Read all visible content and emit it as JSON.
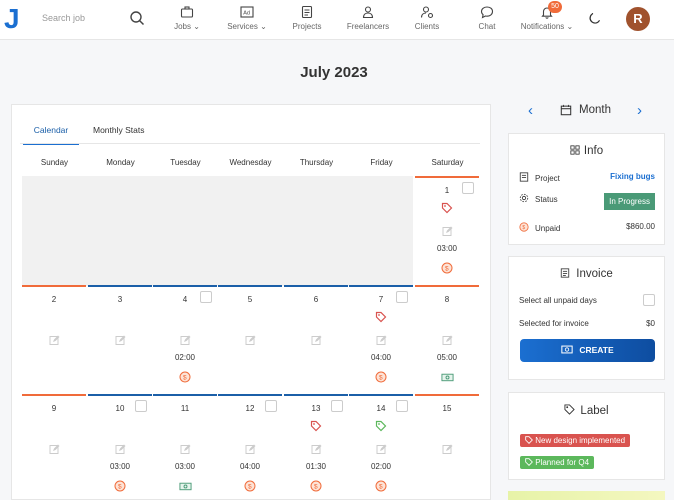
{
  "nav": {
    "search_placeholder": "Search job",
    "items": [
      {
        "label": "Jobs",
        "icon": "briefcase-icon",
        "dropdown": true
      },
      {
        "label": "Services",
        "icon": "ad-icon",
        "dropdown": true
      },
      {
        "label": "Projects",
        "icon": "document-icon"
      },
      {
        "label": "Freelancers",
        "icon": "person-icon"
      },
      {
        "label": "Clients",
        "icon": "client-icon"
      },
      {
        "label": "Chat",
        "icon": "chat-icon"
      },
      {
        "label": "Notifications",
        "icon": "bell-icon",
        "dropdown": true
      }
    ],
    "notification_count": "50",
    "avatar_initial": "R"
  },
  "page": {
    "title": "July 2023"
  },
  "calendar": {
    "tabs": [
      "Calendar",
      "Monthly Stats"
    ],
    "weekdays": [
      "Sunday",
      "Monday",
      "Tuesday",
      "Wednesday",
      "Thursday",
      "Friday",
      "Saturday"
    ],
    "days": [
      {
        "num": "1",
        "time": "03:00",
        "tag": "red",
        "status": "unpaid",
        "bar": "orange",
        "checkbox": true
      },
      {
        "num": "2",
        "bar": "orange"
      },
      {
        "num": "3",
        "bar": "blue"
      },
      {
        "num": "4",
        "time": "02:00",
        "status": "unpaid",
        "bar": "blue",
        "checkbox": true
      },
      {
        "num": "5",
        "bar": "blue"
      },
      {
        "num": "6",
        "bar": "blue"
      },
      {
        "num": "7",
        "time": "04:00",
        "tag": "red",
        "status": "unpaid",
        "bar": "blue",
        "checkbox": true
      },
      {
        "num": "8",
        "time": "05:00",
        "status": "paid",
        "bar": "orange"
      },
      {
        "num": "9",
        "bar": "orange"
      },
      {
        "num": "10",
        "time": "03:00",
        "status": "unpaid",
        "bar": "blue",
        "checkbox": true
      },
      {
        "num": "11",
        "time": "03:00",
        "status": "paid",
        "bar": "blue"
      },
      {
        "num": "12",
        "time": "04:00",
        "status": "unpaid",
        "bar": "blue",
        "checkbox": true
      },
      {
        "num": "13",
        "time": "01:30",
        "tag": "red",
        "status": "unpaid",
        "bar": "blue",
        "checkbox": true
      },
      {
        "num": "14",
        "time": "02:00",
        "tag": "green",
        "status": "unpaid",
        "bar": "blue",
        "checkbox": true
      },
      {
        "num": "15",
        "bar": "orange"
      }
    ]
  },
  "month_nav": {
    "label": "Month"
  },
  "info": {
    "title": "Info",
    "project_label": "Project",
    "project_value": "Fixing bugs",
    "status_label": "Status",
    "status_value": "In Progress",
    "unpaid_label": "Unpaid",
    "unpaid_value": "$860.00"
  },
  "invoice": {
    "title": "Invoice",
    "select_all_label": "Select all unpaid days",
    "selected_label": "Selected for invoice",
    "selected_value": "$0",
    "create_label": "CREATE"
  },
  "labels": {
    "title": "Label",
    "items": [
      {
        "text": "New design implemented",
        "color": "#d9534f"
      },
      {
        "text": "Planned for Q4",
        "color": "#5cb85c"
      }
    ]
  },
  "colors": {
    "accent": "#1b6fd1",
    "orange": "#f06b3a",
    "status_green": "#4a9a77"
  }
}
